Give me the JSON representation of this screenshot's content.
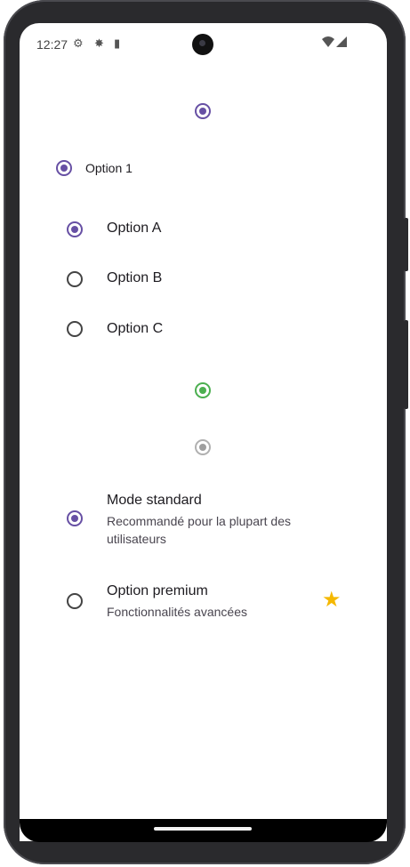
{
  "status_bar": {
    "time": "12:27",
    "icons": [
      "settings-gear-icon",
      "usb-debug-icon",
      "sd-card-icon",
      "wifi-icon",
      "signal-icon"
    ]
  },
  "colors": {
    "primary": "#6750A4",
    "success": "#4CAF50",
    "disabled": "#9E9E9E",
    "star": "#F5B800",
    "unselected_border": "#49454F"
  },
  "radios": {
    "standalone_selected": true,
    "option1": {
      "label": "Option 1",
      "selected": true
    },
    "group": [
      {
        "label": "Option A",
        "selected": true
      },
      {
        "label": "Option B",
        "selected": false
      },
      {
        "label": "Option C",
        "selected": false
      }
    ],
    "green_selected": true,
    "disabled_selected": true
  },
  "list": {
    "standard": {
      "title": "Mode standard",
      "subtitle_line1": "Recommandé pour la plupart des",
      "subtitle_line2": "utilisateurs",
      "selected": true
    },
    "premium": {
      "title": "Option premium",
      "subtitle": "Fonctionnalités avancées",
      "selected": false,
      "icon": "star-icon"
    }
  }
}
